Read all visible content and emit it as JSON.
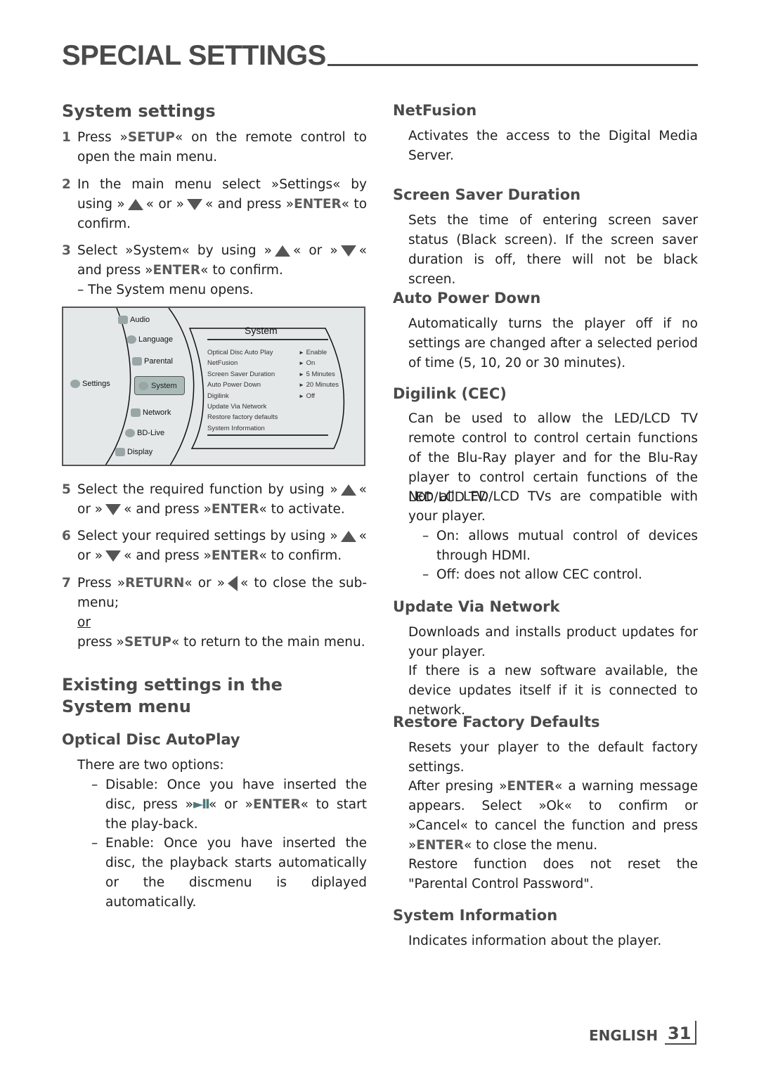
{
  "header": {
    "title": "SPECIAL SETTINGS"
  },
  "left": {
    "section_title": "System settings",
    "steps": [
      {
        "num": "1",
        "parts": [
          "Press »",
          "SETUP",
          "« on the remote control to open the main menu."
        ]
      },
      {
        "num": "2",
        "pre": "In the main menu select »Settings« by using »",
        "mid1": "« or »",
        "mid2": "« and press »",
        "key": "ENTER",
        "post": "« to confirm."
      },
      {
        "num": "3",
        "pre": "Select »System« by using »",
        "mid1": "« or »",
        "mid2": "« and press »",
        "key": "ENTER",
        "post": "« to confirm.",
        "note": "– The System menu opens."
      },
      {
        "num": "5",
        "pre": "Select the required function by using »",
        "mid1": "« or »",
        "mid2": "« and press »",
        "key": "ENTER",
        "post": "« to activate."
      },
      {
        "num": "6",
        "pre": "Select your required settings by using »",
        "mid1": "« or »",
        "mid2": "« and press »",
        "key": "ENTER",
        "post": "« to confirm."
      },
      {
        "num": "7",
        "pre": "Press »",
        "key": "RETURN",
        "mid": "« or »",
        "post": "« to close the sub-menu;",
        "or": "or",
        "pre2": "press »",
        "key2": "SETUP",
        "post2": "« to return to the main menu."
      }
    ],
    "menu_screenshot": {
      "root": "Settings",
      "categories": [
        "Audio",
        "Language",
        "Parental",
        "System",
        "Network",
        "BD-Live",
        "Display"
      ],
      "selected": "System",
      "panel_title": "System",
      "options": [
        {
          "label": "Optical Disc Auto Play",
          "value": "Enable"
        },
        {
          "label": "NetFusion",
          "value": "On"
        },
        {
          "label": "Screen Saver Duration",
          "value": "5 Minutes"
        },
        {
          "label": "Auto Power Down",
          "value": "20 Minutes"
        },
        {
          "label": "Digilink",
          "value": "Off"
        },
        {
          "label": "Update Via Network",
          "value": ""
        },
        {
          "label": "Restore factory defaults",
          "value": ""
        },
        {
          "label": "System Information",
          "value": ""
        }
      ]
    },
    "existing_title": "Existing settings in the System menu",
    "optical": {
      "title": "Optical Disc AutoPlay",
      "intro": "There are two options:",
      "disable_pre": "Disable: Once you have inserted the disc, press »",
      "disable_mid": "« or »",
      "disable_key": "ENTER",
      "disable_post": "« to start the play-back.",
      "enable": "Enable: Once you have inserted the disc, the playback starts automatically or the discmenu is diplayed automatically."
    }
  },
  "right": {
    "netfusion": {
      "title": "NetFusion",
      "text": "Activates the access to the Digital Media Server."
    },
    "screensaver": {
      "title": "Screen Saver Duration",
      "text": "Sets the time of entering screen saver status (Black screen). If the screen saver duration is off, there will not be black screen."
    },
    "autopower": {
      "title": "Auto Power Down",
      "text": "Automatically turns the player off if no settings are changed after a selected period of time (5, 10, 20 or 30 minutes)."
    },
    "digilink": {
      "title": "Digilink (CEC)",
      "text1": "Can be used to allow the LED/LCD TV remote control to control certain functions of the Blu-Ray player and for the Blu-Ray player to control certain functions of the LED/LCD TV.",
      "text2": "Not all LED/LCD TVs are compatible with your player.",
      "on": "On: allows mutual control of devices through HDMI.",
      "off": "Off: does not allow CEC control."
    },
    "update": {
      "title": "Update Via Network",
      "text1": "Downloads and installs product updates for your player.",
      "text2": "If there is a new software available, the device updates itself if it is connected to network."
    },
    "restore": {
      "title": "Restore Factory Defaults",
      "text1": "Resets your player to the default factory settings.",
      "t2_pre": "After presing »",
      "t2_key": "ENTER",
      "t2_mid": "« a warning message appears. Select »Ok« to confirm or »Cancel« to cancel the function and press »",
      "t2_key2": "ENTER",
      "t2_post": "« to close the menu.",
      "text3": "Restore function does not reset the \"Parental Control Password\"."
    },
    "sysinfo": {
      "title": "System Information",
      "text": "Indicates information about the player."
    }
  },
  "footer": {
    "language": "ENGLISH",
    "page": "31"
  }
}
